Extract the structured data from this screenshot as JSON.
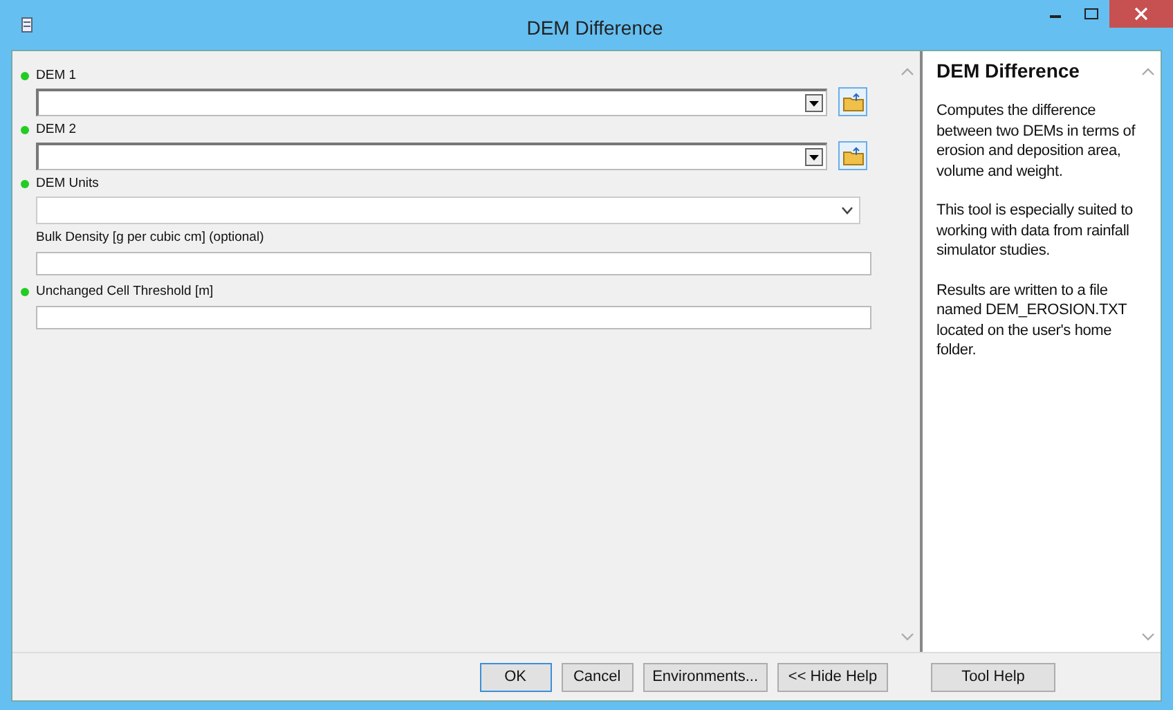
{
  "window": {
    "title": "DEM Difference"
  },
  "parameters": [
    {
      "label": "DEM 1",
      "required": true,
      "kind": "combo-browse"
    },
    {
      "label": "DEM 2",
      "required": true,
      "kind": "combo-browse"
    },
    {
      "label": "DEM Units",
      "required": true,
      "kind": "dropdown"
    },
    {
      "label": "Bulk Density [g per cubic cm] (optional)",
      "required": false,
      "kind": "text"
    },
    {
      "label": "Unchanged Cell Threshold [m]",
      "required": true,
      "kind": "text"
    }
  ],
  "help": {
    "title": "DEM Difference",
    "paragraphs": [
      "Computes the difference between two DEMs in terms of erosion and deposition area, volume and weight.",
      "This tool is especially suited to working with data from rainfall simulator studies.",
      "Results are written to a file named DEM_EROSION.TXT located on the user's home folder."
    ]
  },
  "buttons": [
    {
      "label": "OK",
      "focused": true
    },
    {
      "label": "Cancel",
      "focused": false
    },
    {
      "label": "Environments...",
      "focused": false
    },
    {
      "label": "<< Hide Help",
      "focused": false
    }
  ],
  "help_button": {
    "label": "Tool Help"
  }
}
